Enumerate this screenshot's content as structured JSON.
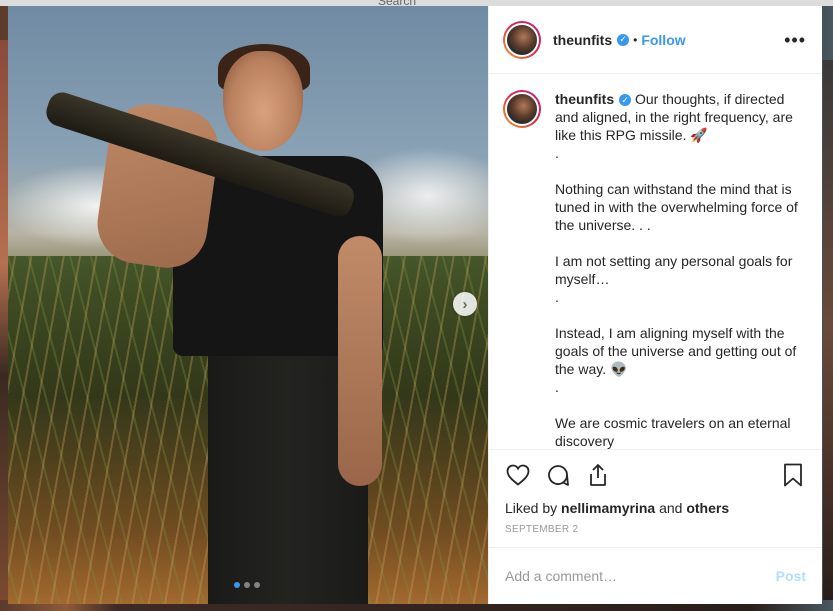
{
  "backdrop": {
    "search_ghost": "Search"
  },
  "post": {
    "username": "theunfits",
    "verified_mark": "✓",
    "bullet": "•",
    "follow_label": "Follow",
    "more_icon": "•••",
    "caption_user": "theunfits",
    "caption_text": " Our thoughts, if directed and aligned, in the right frequency, are like this RPG missile. 🚀\n.\n\nNothing can withstand the mind that is tuned in with the overwhelming force of the universe. . .\n\nI am not setting any personal goals for myself…\n.\n\nInstead, I am aligning myself with the goals of the universe and getting out of the way. 👽\n.\n\nWe are cosmic travelers on an eternal discovery",
    "likes_prefix": "Liked by ",
    "likes_user": "nellimamyrina",
    "likes_and": " and ",
    "likes_others": "others",
    "date": "SEPTEMBER 2",
    "comment_placeholder": "Add a comment…",
    "post_label": "Post",
    "carousel": {
      "count": 3,
      "active": 0
    }
  },
  "icons": {
    "like": "heart-icon",
    "comment": "comment-icon",
    "share": "share-icon",
    "save": "bookmark-icon",
    "next": "chevron-right-icon"
  },
  "colors": {
    "accent": "#3897f0",
    "text": "#262626",
    "muted": "#999999",
    "post_disabled": "#b2dffc"
  }
}
